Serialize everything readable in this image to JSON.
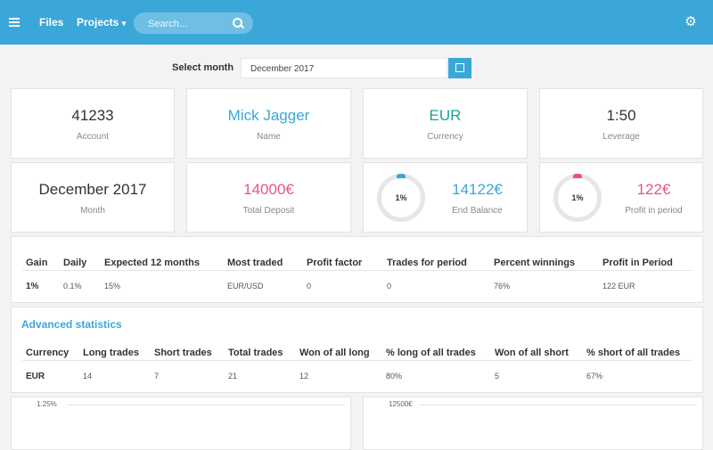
{
  "nav": {
    "files": "Files",
    "projects": "Projects",
    "projects_caret": "▾",
    "search_placeholder": "Search...",
    "gear_glyph": "⚙"
  },
  "month_selector": {
    "label": "Select month",
    "value": "December 2017"
  },
  "cards_row1": [
    {
      "value": "41233",
      "label": "Account",
      "color": "#333333"
    },
    {
      "value": "Mick Jagger",
      "label": "Name",
      "color": "#3ba7d8"
    },
    {
      "value": "EUR",
      "label": "Currency",
      "color": "#1aa39a"
    },
    {
      "value": "1:50",
      "label": "Leverage",
      "color": "#333333"
    }
  ],
  "cards_row2": [
    {
      "value": "December 2017",
      "label": "Month",
      "color": "#333333"
    },
    {
      "value": "14000€",
      "label": "Total Deposit",
      "color": "#e8528a"
    },
    {
      "value": "14122€",
      "label": "End Balance",
      "color": "#3ba7d8",
      "gauge": "1%",
      "gauge_fraction": 0.01,
      "gauge_color": "#3ba7d8"
    },
    {
      "value": "122€",
      "label": "Profit in period",
      "color": "#e8528a",
      "gauge": "1%",
      "gauge_fraction": 0.01,
      "gauge_color": "#e8528a"
    }
  ],
  "summary": {
    "headers": [
      "Gain",
      "Daily",
      "Expected 12 months",
      "Most traded",
      "Profit factor",
      "Trades for period",
      "Percent winnings",
      "Profit in Period"
    ],
    "row": [
      "1%",
      "0.1%",
      "15%",
      "EUR/USD",
      "0",
      "0",
      "76%",
      "122 EUR"
    ]
  },
  "advanced": {
    "title": "Advanced statistics",
    "headers": [
      "Currency",
      "Long trades",
      "Short trades",
      "Total trades",
      "Won of all long",
      "% long of all trades",
      "Won of all short",
      "% short of all trades"
    ],
    "row": [
      "EUR",
      "14",
      "7",
      "21",
      "12",
      "80%",
      "5",
      "67%"
    ]
  },
  "charts": [
    {
      "top_tick": "1.25%"
    },
    {
      "top_tick": "12500€"
    }
  ]
}
